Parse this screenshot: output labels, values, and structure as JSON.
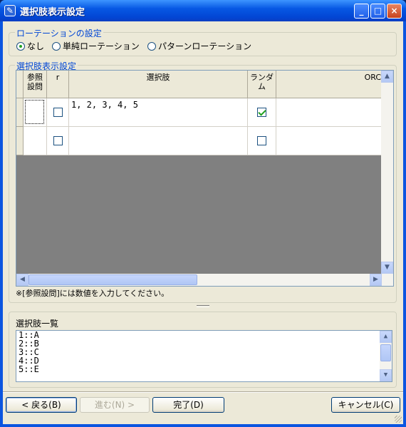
{
  "window": {
    "title": "選択肢表示設定",
    "buttons": {
      "minimize": "_",
      "maximize": "□",
      "close": "×"
    }
  },
  "rotation_group": {
    "label": "ローテーションの設定",
    "options": [
      {
        "label": "なし",
        "selected": true
      },
      {
        "label": "単純ローテーション",
        "selected": false
      },
      {
        "label": "パターンローテーション",
        "selected": false
      }
    ]
  },
  "choices_group": {
    "label": "選択肢表示設定",
    "columns": [
      "参照\n設問",
      "r",
      "選択肢",
      "ランダム",
      "ORC"
    ],
    "rows": [
      {
        "ref": "",
        "r": false,
        "choices": "1, 2, 3, 4, 5",
        "random": true,
        "orc": ""
      },
      {
        "ref": "",
        "r": false,
        "choices": "",
        "random": false,
        "orc": ""
      }
    ],
    "note": "※[参照設問]には数値を入力してください。"
  },
  "choice_list": {
    "label": "選択肢一覧",
    "items": [
      "1::A",
      "2::B",
      "3::C",
      "4::D",
      "5::E"
    ]
  },
  "footer": {
    "back": "< 戻る(B)",
    "next": "進む(N) >",
    "finish": "完了(D)",
    "cancel": "キャンセル(C)"
  }
}
